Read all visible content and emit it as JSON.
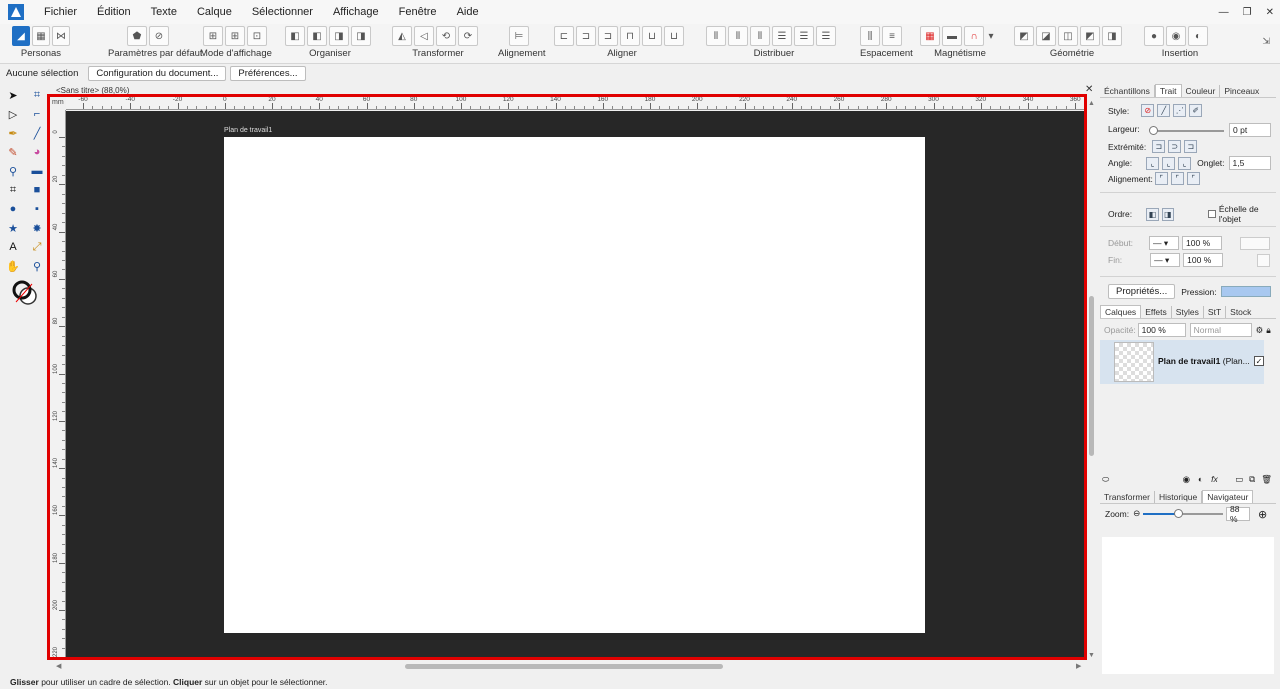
{
  "menubar": {
    "items": [
      "Fichier",
      "Édition",
      "Texte",
      "Calque",
      "Sélectionner",
      "Affichage",
      "Fenêtre",
      "Aide"
    ]
  },
  "toolbar": {
    "groups": [
      {
        "label": "Personas"
      },
      {
        "label": "Paramètres par défaut"
      },
      {
        "label": "Mode d'affichage"
      },
      {
        "label": "Organiser"
      },
      {
        "label": "Transformer"
      },
      {
        "label": "Alignement"
      },
      {
        "label": "Aligner"
      },
      {
        "label": "Distribuer"
      },
      {
        "label": "Espacement"
      },
      {
        "label": "Magnétisme"
      },
      {
        "label": "Géométrie"
      },
      {
        "label": "Insertion"
      }
    ]
  },
  "context": {
    "selection": "Aucune sélection",
    "doc_setup": "Configuration du document...",
    "preferences": "Préférences..."
  },
  "document": {
    "tab_title": "<Sans titre> (88,0%)",
    "artboard_label": "Plan de travail1",
    "ruler_unit": "mm",
    "ruler_h_ticks": [
      "-60",
      "-40",
      "-20",
      "0",
      "20",
      "40",
      "60",
      "80",
      "100",
      "120",
      "140",
      "160",
      "180",
      "200",
      "220",
      "240",
      "260",
      "280",
      "300",
      "320",
      "340",
      "360"
    ],
    "ruler_v_ticks": [
      "0",
      "20",
      "40",
      "60",
      "80",
      "100",
      "120",
      "140",
      "160",
      "180",
      "200",
      "220"
    ]
  },
  "stroke_panel": {
    "tabs": [
      "Échantillons",
      "Trait",
      "Couleur",
      "Pinceaux"
    ],
    "active_tab": "Trait",
    "style_label": "Style:",
    "width_label": "Largeur:",
    "width_value": "0 pt",
    "cap_label": "Extrémité:",
    "join_label": "Angle:",
    "miter_label": "Onglet:",
    "miter_value": "1,5",
    "align_label": "Alignement:",
    "order_label": "Ordre:",
    "scale_label": "Échelle de l'objet",
    "start_label": "Début:",
    "start_value": "100 %",
    "end_label": "Fin:",
    "end_value": "100 %",
    "properties_btn": "Propriétés...",
    "pressure_label": "Pression:"
  },
  "layers_panel": {
    "tabs": [
      "Calques",
      "Effets",
      "Styles",
      "StT",
      "Stock"
    ],
    "opacity_label": "Opacité:",
    "opacity_value": "100 %",
    "blend_value": "Normal",
    "layer_name": "Plan de travail1",
    "layer_type": " (Plan..."
  },
  "navigator_panel": {
    "tabs": [
      "Transformer",
      "Historique",
      "Navigateur"
    ],
    "zoom_label": "Zoom:",
    "zoom_value": "88 %",
    "zoom_fraction": 0.88
  },
  "status": {
    "part1": "Glisser",
    "part2": " pour utiliser un cadre de sélection. ",
    "part3": "Cliquer",
    "part4": " sur un objet pour le sélectionner."
  },
  "colors": {
    "accent": "#1f6fc4",
    "canvas": "#272727",
    "highlight": "#e00000"
  }
}
